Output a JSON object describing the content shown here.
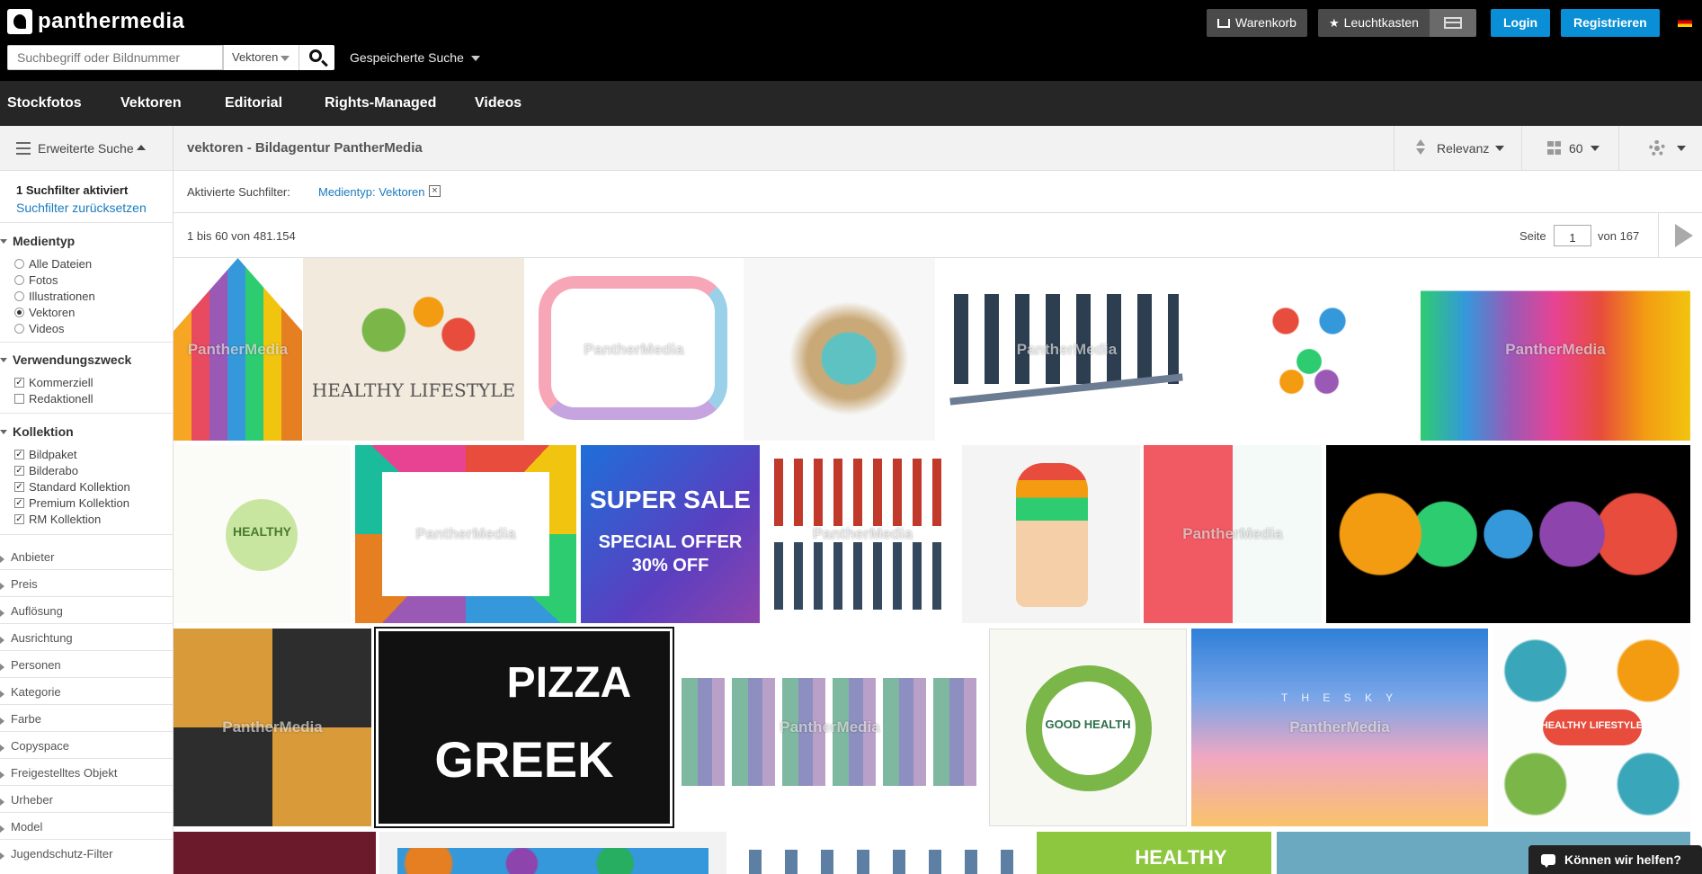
{
  "brand": {
    "name": "panthermedia"
  },
  "search": {
    "placeholder": "Suchbegriff oder Bildnummer",
    "type": "Vektoren",
    "saved": "Gespeicherte Suche"
  },
  "header": {
    "cart": "Warenkorb",
    "lightbox": "Leuchtkasten",
    "login": "Login",
    "register": "Registrieren"
  },
  "nav": [
    "Stockfotos",
    "Vektoren",
    "Editorial",
    "Rights-Managed",
    "Videos"
  ],
  "sidebar": {
    "advanced": "Erweiterte Suche",
    "filter_active": "1 Suchfilter aktiviert",
    "filter_reset": "Suchfilter zurücksetzen",
    "groups": [
      {
        "title": "Medientyp",
        "options": [
          "Alle Dateien",
          "Fotos",
          "Illustrationen",
          "Vektoren",
          "Videos"
        ]
      },
      {
        "title": "Verwendungszweck",
        "options": [
          "Kommerziell",
          "Redaktionell"
        ]
      },
      {
        "title": "Kollektion",
        "options": [
          "Bildpaket",
          "Bilderabo",
          "Standard Kollektion",
          "Premium Kollektion",
          "RM Kollektion"
        ]
      }
    ],
    "collapsed": [
      "Anbieter",
      "Preis",
      "Auflösung",
      "Ausrichtung",
      "Personen",
      "Kategorie",
      "Farbe",
      "Copyspace",
      "Freigestelltes Objekt",
      "Urheber",
      "Model",
      "Jugendschutz-Filter"
    ]
  },
  "results": {
    "title": "vektoren - Bildagentur PantherMedia",
    "sort": "Relevanz",
    "per_page": "60",
    "active_label": "Aktivierte Suchfilter:",
    "active_filter": "Medientyp: Vektoren",
    "count": "1 bis 60 von 481.154",
    "page_label": "Seite",
    "page_value": "1",
    "page_of": "von 167",
    "watermark": "PantherMedia",
    "tiles": [
      {
        "name": "thumb-colorful-arrows"
      },
      {
        "name": "thumb-healthy-lifestyle",
        "text": "HEALTHY LIFESTYLE"
      },
      {
        "name": "thumb-business-meeting-path"
      },
      {
        "name": "thumb-particle-runner"
      },
      {
        "name": "thumb-business-people-seesaw"
      },
      {
        "name": "thumb-heart-food-icons"
      },
      {
        "name": "thumb-crowd-silhouettes"
      },
      {
        "name": "thumb-healthy-doodles",
        "text": "HEALTHY"
      },
      {
        "name": "thumb-mosaic-frame"
      },
      {
        "name": "thumb-super-sale",
        "text": "SUPER SALE",
        "text2": "SPECIAL OFFER 30% OFF"
      },
      {
        "name": "thumb-age-groups"
      },
      {
        "name": "thumb-waist-measure"
      },
      {
        "name": "thumb-pattern-set"
      },
      {
        "name": "thumb-wellness-icons"
      },
      {
        "name": "thumb-golden-patterns"
      },
      {
        "name": "thumb-pizza-chalkboard",
        "text": "PIZZA",
        "text2": "GREEK"
      },
      {
        "name": "thumb-walking-people"
      },
      {
        "name": "thumb-good-health-circle",
        "text": "GOOD HEALTH"
      },
      {
        "name": "thumb-sky-blur",
        "text": "T H E   S K Y"
      },
      {
        "name": "thumb-healthy-lifestyle-bubbles",
        "text": "HEALTHY LIFESTYLE"
      },
      {
        "name": "thumb-dark-red"
      },
      {
        "name": "thumb-world-map-icons"
      },
      {
        "name": "thumb-office-people"
      },
      {
        "name": "thumb-healthy-green",
        "text": "HEALTHY"
      },
      {
        "name": "thumb-teal"
      }
    ]
  },
  "help": "Können wir helfen?",
  "colors": {
    "accent": "#0a8fd6",
    "link": "#1a7bbf",
    "nav": "#262626"
  }
}
